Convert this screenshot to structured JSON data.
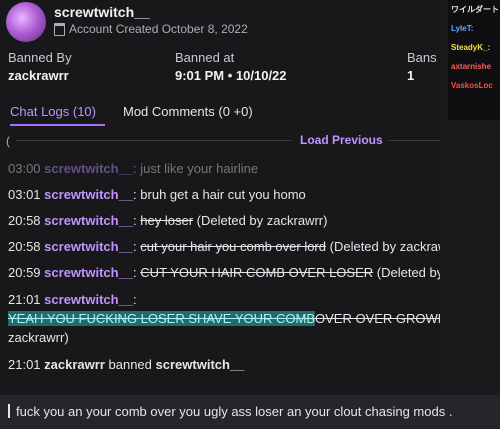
{
  "profile": {
    "username": "screwtwitch__",
    "created": "Account Created October 8, 2022"
  },
  "stats": {
    "banned_by_label": "Banned By",
    "banned_by": "zackrawrr",
    "banned_at_label": "Banned at",
    "banned_at": "9:01 PM • 10/10/22",
    "bans_label": "Bans",
    "bans": "1"
  },
  "tabs": {
    "chat_logs": "Chat Logs (10)",
    "mod_comments": "Mod Comments (0 +0)"
  },
  "load_previous": "Load Previous",
  "open_paren": "(",
  "logs": [
    {
      "time": "03:00",
      "user": "screwtwitch__",
      "colon": ":",
      "text": "just like your hairline"
    },
    {
      "time": "03:01",
      "user": "screwtwitch__",
      "colon": ":",
      "text": "bruh get a hair cut you homo"
    },
    {
      "time": "20:58",
      "user": "screwtwitch__",
      "colon": ":",
      "struck": "hey loser",
      "note": "(Deleted by zackrawrr)"
    },
    {
      "time": "20:58",
      "user": "screwtwitch__",
      "colon": ":",
      "struck": "cut your hair you comb over lord",
      "note": "(Deleted by zackrawrr)"
    },
    {
      "time": "20:59",
      "user": "screwtwitch__",
      "colon": ":",
      "struck": "CUT YOUR HAIR COMB OVER LOSER",
      "note": "(Deleted by zackraw"
    },
    {
      "time": "21:01",
      "user": "screwtwitch__",
      "colon": ":",
      "highlight": "YEAH YOU FUCKING LOSER SHAVE YOUR COMB",
      "struck": "OVER OVER GROWN COMB O",
      "note": "zackrawrr)"
    }
  ],
  "ban_line": {
    "time": "21:01",
    "mod": "zackrawrr",
    "action": "banned",
    "user": "screwtwitch__"
  },
  "side_chat": [
    {
      "name": "ワイルダート",
      "color": "#e6e6ea"
    },
    {
      "name": "LyleT:",
      "color": "#6ea8ff"
    },
    {
      "name": "SteadyK_:",
      "color": "#f2e14d"
    },
    {
      "name": "axtarnishe",
      "color": "#ff5a5a"
    },
    {
      "name": "VaskosLoc",
      "color": "#ff4d4d"
    }
  ],
  "bottom_message": "fuck you an your comb over you ugly ass loser an your clout chasing mods ."
}
